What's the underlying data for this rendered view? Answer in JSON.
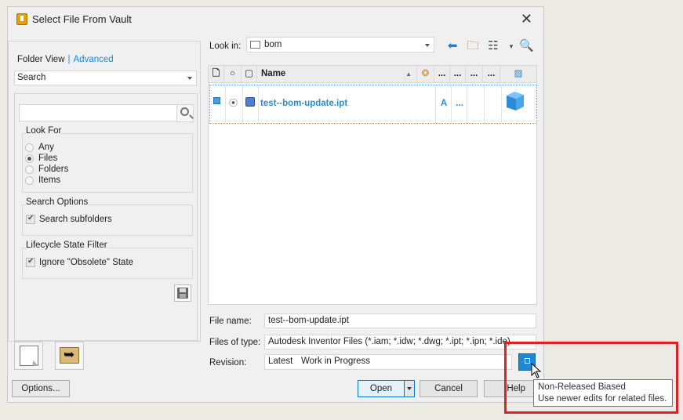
{
  "dialog": {
    "title": "Select File From Vault",
    "close_glyph": "✕"
  },
  "left": {
    "folder_view": "Folder View",
    "separator": "|",
    "advanced": "Advanced",
    "search_mode": "Search",
    "look_for": {
      "title": "Look For",
      "options": [
        "Any",
        "Files",
        "Folders",
        "Items"
      ],
      "selected": "Files"
    },
    "search_options": {
      "title": "Search Options",
      "search_subfolders": "Search subfolders"
    },
    "lifecycle": {
      "title": "Lifecycle State Filter",
      "ignore_obsolete": "Ignore \"Obsolete\" State"
    },
    "options_label": "Options..."
  },
  "right": {
    "look_in_label": "Look in:",
    "look_in_value": "bom",
    "columns": {
      "name": "Name",
      "dots": "..."
    },
    "file": {
      "name": "test--bom-update.ipt",
      "col_a": "A",
      "col_dots": "..."
    },
    "file_name_label": "File name:",
    "file_name_value": "test--bom-update.ipt",
    "files_of_type_label": "Files of type:",
    "files_of_type_value": "Autodesk Inventor Files (*.iam; *.idw; *.dwg; *.ipt; *.ipn; *.ide)",
    "revision_label": "Revision:",
    "revision_value": "Latest",
    "revision_state": "Work in Progress"
  },
  "buttons": {
    "open": "Open",
    "cancel": "Cancel",
    "help": "Help"
  },
  "tooltip": {
    "title": "Non-Released Biased",
    "body": "Use newer edits for related files."
  },
  "colors": {
    "accent": "#1a87d6",
    "highlight_box": "#e01f1f",
    "file_link": "#2a8dd4"
  }
}
